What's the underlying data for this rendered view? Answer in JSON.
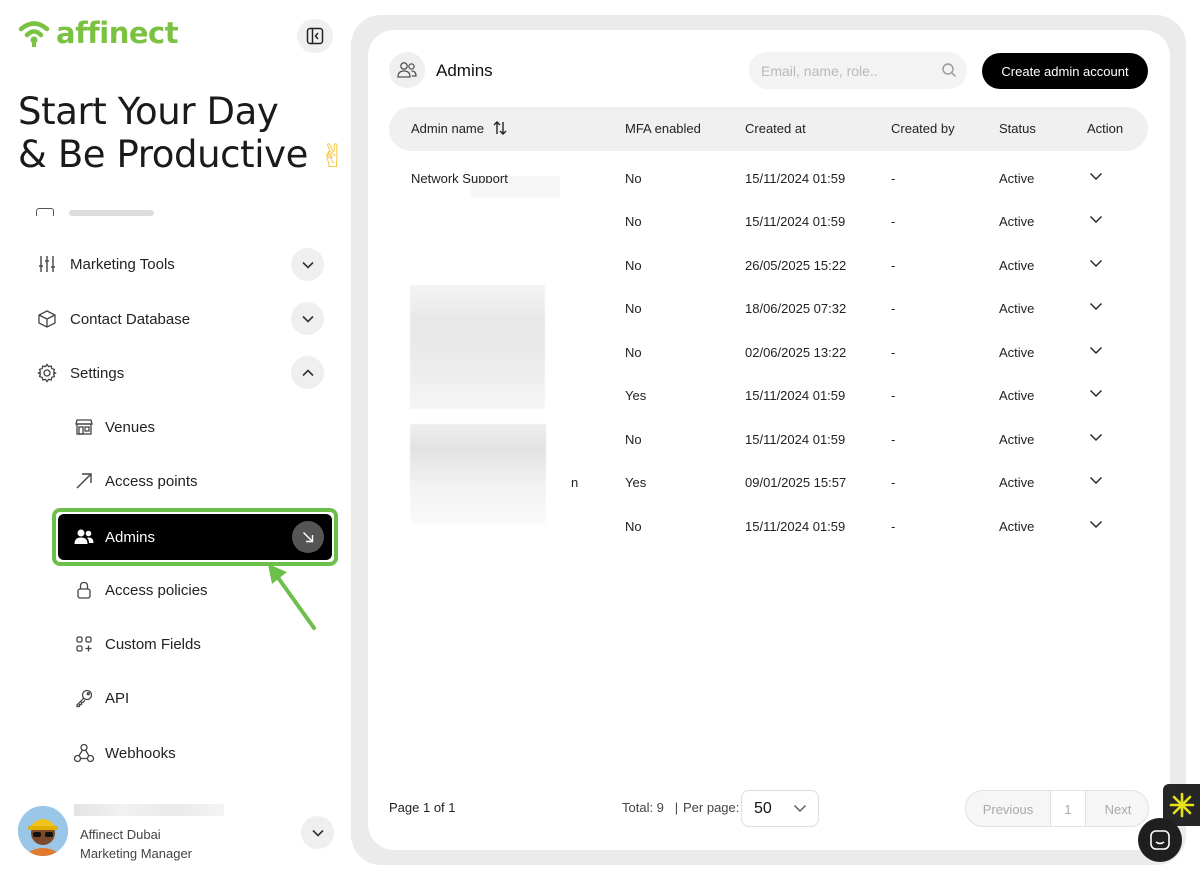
{
  "brand": {
    "name": "affinect",
    "color": "#7cc242"
  },
  "sidebar": {
    "headline_line1": "Start Your Day",
    "headline_line2": "& Be Productive",
    "headline_emoji": "✌",
    "items": [
      {
        "label": "Marketing Tools",
        "icon": "sliders-icon",
        "expanded": false
      },
      {
        "label": "Contact Database",
        "icon": "cube-icon",
        "expanded": false
      },
      {
        "label": "Settings",
        "icon": "gear-icon",
        "expanded": true
      }
    ],
    "sub_items": [
      {
        "label": "Venues",
        "icon": "store-icon"
      },
      {
        "label": "Access points",
        "icon": "arrow-up-right-icon"
      },
      {
        "label": "Admins",
        "icon": "users-icon",
        "active": true
      },
      {
        "label": "Access policies",
        "icon": "lock-icon"
      },
      {
        "label": "Custom Fields",
        "icon": "grid-plus-icon"
      },
      {
        "label": "API",
        "icon": "key-icon"
      },
      {
        "label": "Webhooks",
        "icon": "webhook-icon"
      }
    ],
    "user": {
      "company": "Affinect Dubai",
      "role": "Marketing Manager"
    }
  },
  "main": {
    "title": "Admins",
    "search_placeholder": "Email, name, role..",
    "create_button": "Create admin account",
    "columns": {
      "name": "Admin name",
      "mfa": "MFA enabled",
      "created_at": "Created at",
      "created_by": "Created by",
      "status": "Status",
      "action": "Action"
    },
    "rows": [
      {
        "name": "Network Support",
        "mfa": "No",
        "created_at": "15/11/2024 01:59",
        "created_by": "-",
        "status": "Active"
      },
      {
        "name": "",
        "mfa": "No",
        "created_at": "15/11/2024 01:59",
        "created_by": "-",
        "status": "Active"
      },
      {
        "name": "",
        "mfa": "No",
        "created_at": "26/05/2025 15:22",
        "created_by": "-",
        "status": "Active"
      },
      {
        "name": "",
        "mfa": "No",
        "created_at": "18/06/2025 07:32",
        "created_by": "-",
        "status": "Active"
      },
      {
        "name": "",
        "mfa": "No",
        "created_at": "02/06/2025 13:22",
        "created_by": "-",
        "status": "Active"
      },
      {
        "name": "",
        "mfa": "Yes",
        "created_at": "15/11/2024 01:59",
        "created_by": "-",
        "status": "Active"
      },
      {
        "name": "",
        "mfa": "No",
        "created_at": "15/11/2024 01:59",
        "created_by": "-",
        "status": "Active"
      },
      {
        "name": "n",
        "mfa": "Yes",
        "created_at": "09/01/2025 15:57",
        "created_by": "-",
        "status": "Active"
      },
      {
        "name": "",
        "mfa": "No",
        "created_at": "15/11/2024 01:59",
        "created_by": "-",
        "status": "Active"
      }
    ],
    "footer": {
      "page": "Page 1 of 1",
      "total": "Total: 9",
      "separator": "|",
      "per_page_label": "Per page:",
      "per_page_value": "50",
      "prev": "Previous",
      "current": "1",
      "next": "Next"
    }
  },
  "colors": {
    "accent_green": "#6cc04a",
    "active_bg": "#000000"
  }
}
